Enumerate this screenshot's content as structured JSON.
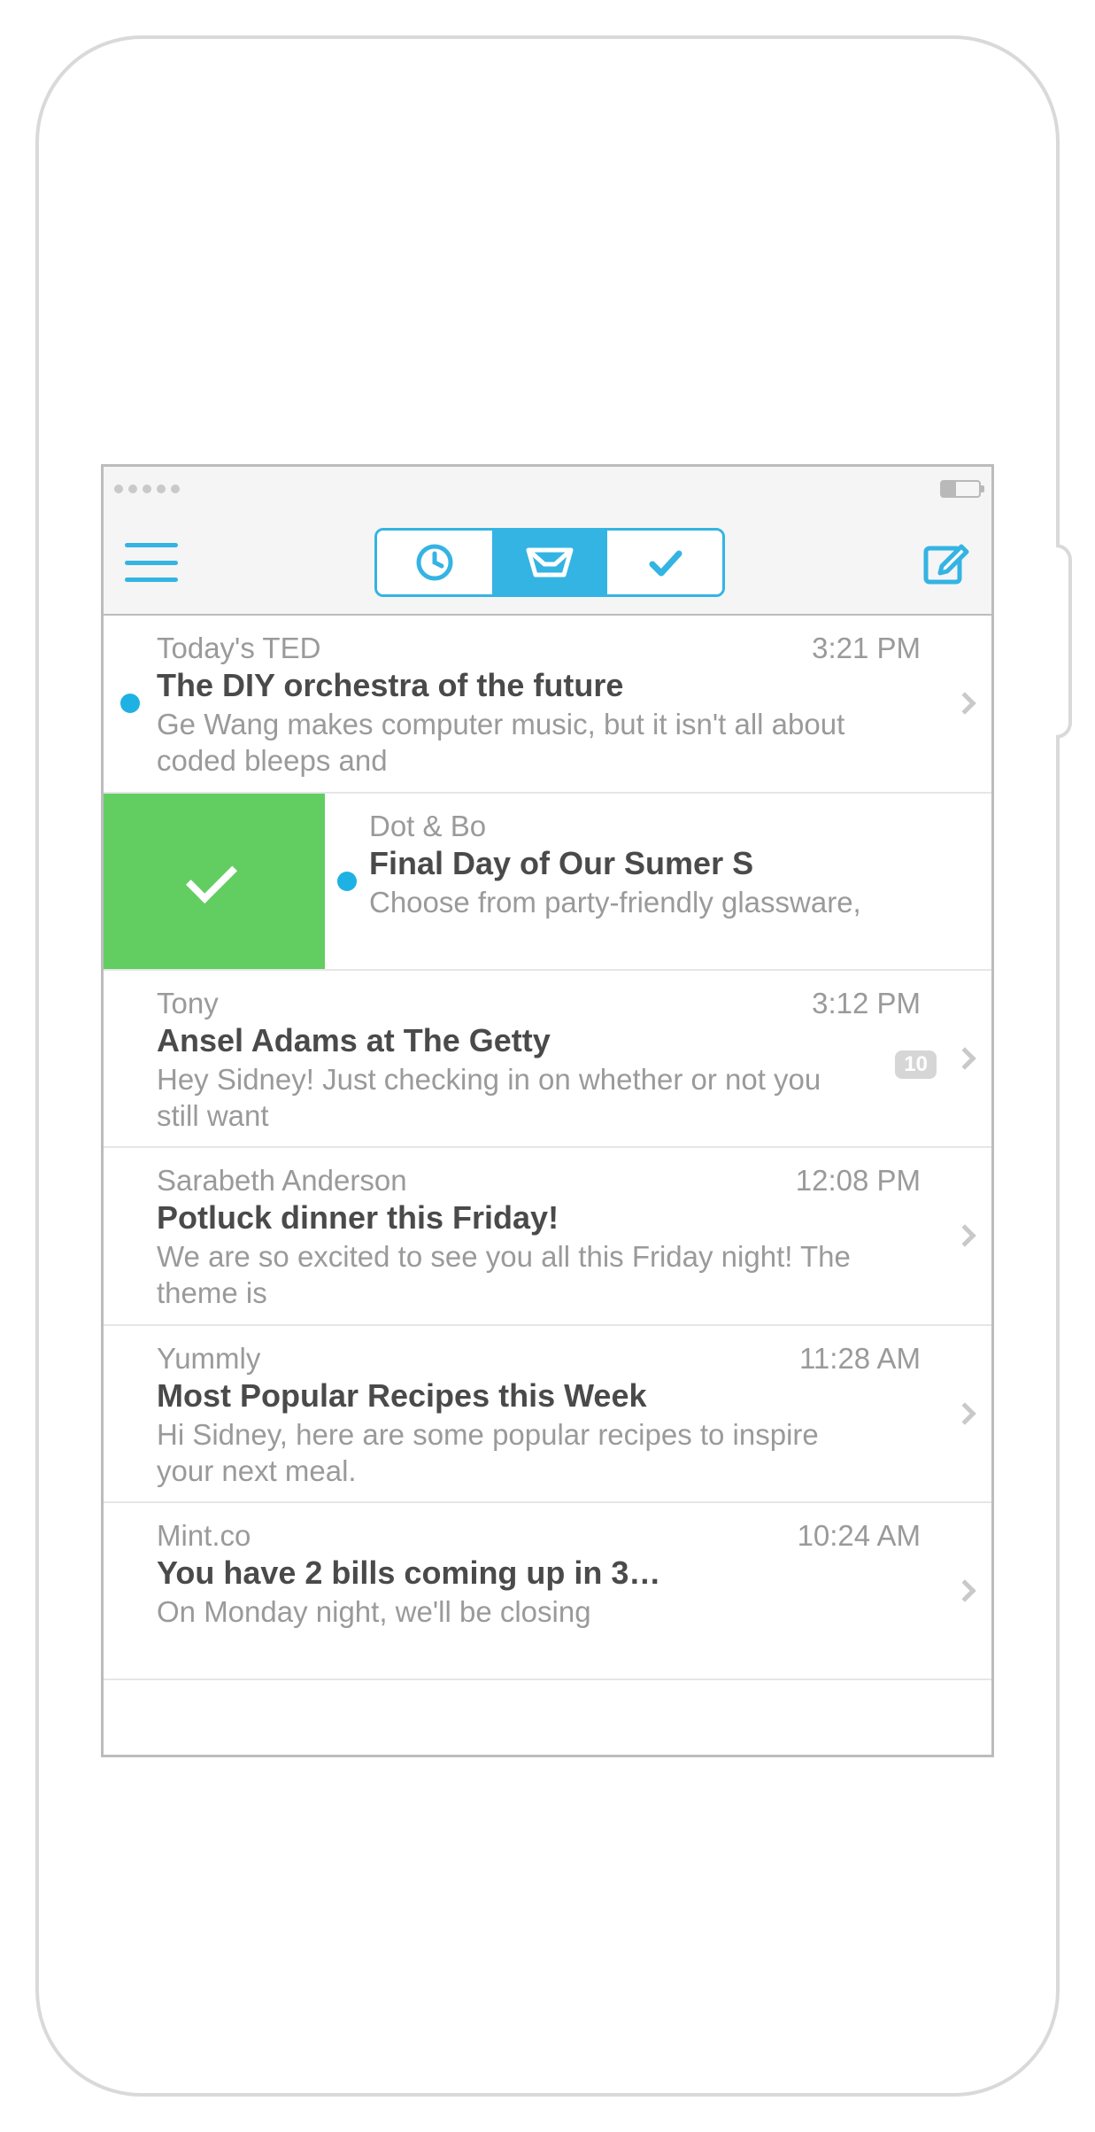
{
  "colors": {
    "accent": "#34b4e3",
    "swipe_green": "#62ce62"
  },
  "nav": {
    "segments": [
      "later",
      "inbox",
      "done"
    ],
    "active_index": 1
  },
  "messages": [
    {
      "sender": "Today's TED",
      "time": "3:21 PM",
      "subject": "The DIY orchestra of the future",
      "preview": "Ge Wang makes computer music, but it isn't all about coded bleeps and",
      "unread": true
    },
    {
      "sender": "Dot & Bo",
      "time": "",
      "subject": "Final Day of Our Sumer S",
      "preview": "Choose from party-friendly glassware,",
      "unread": true,
      "swiped": true
    },
    {
      "sender": "Tony",
      "time": "3:12 PM",
      "subject": "Ansel Adams at The Getty",
      "preview": "Hey Sidney! Just checking in on whether or not you still want",
      "badge": "10"
    },
    {
      "sender": "Sarabeth Anderson",
      "time": "12:08 PM",
      "subject": "Potluck dinner this Friday!",
      "preview": "We are so excited to see you all this Friday night! The theme is"
    },
    {
      "sender": "Yummly",
      "time": "11:28 AM",
      "subject": "Most Popular Recipes this Week",
      "preview": "Hi Sidney, here are some popular recipes to inspire your next meal."
    },
    {
      "sender": "Mint.co",
      "time": "10:24 AM",
      "subject": "You have 2 bills coming up in 3…",
      "preview": "On Monday night, we'll be closing"
    }
  ]
}
